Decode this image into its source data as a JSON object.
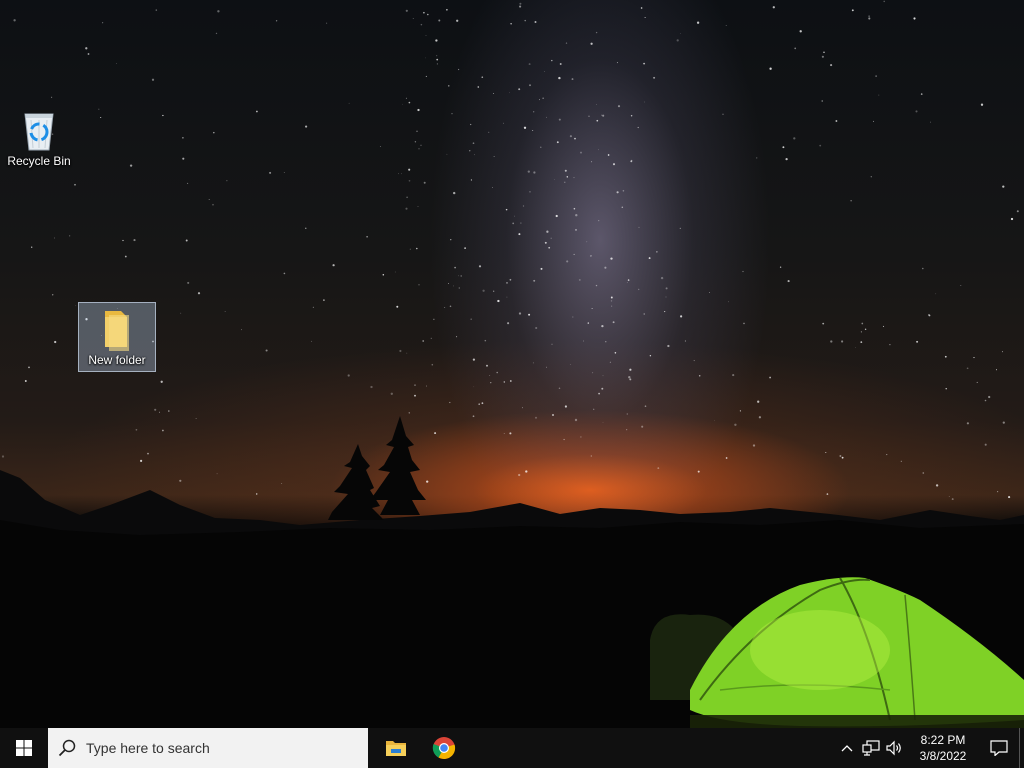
{
  "desktop": {
    "icons": [
      {
        "label": "Recycle Bin",
        "icon": "recycle-bin-icon"
      },
      {
        "label": "New folder",
        "icon": "folder-icon",
        "selected": true
      }
    ]
  },
  "taskbar": {
    "start_icon": "windows-logo-icon",
    "search": {
      "placeholder": "Type here to search",
      "icon": "search-icon"
    },
    "apps": [
      {
        "name": "File Explorer",
        "icon": "file-explorer-icon"
      },
      {
        "name": "Google Chrome",
        "icon": "chrome-icon"
      }
    ],
    "tray": {
      "icons": [
        "chevron-up-icon",
        "network-icon",
        "volume-icon"
      ],
      "time": "8:22 PM",
      "date": "3/8/2022",
      "notification_icon": "action-center-icon"
    }
  },
  "colors": {
    "taskbar_bg": "#101010",
    "search_bg": "#f2f2f2",
    "folder_yellow": "#f3d06a",
    "tent_green": "#8ee22a"
  }
}
